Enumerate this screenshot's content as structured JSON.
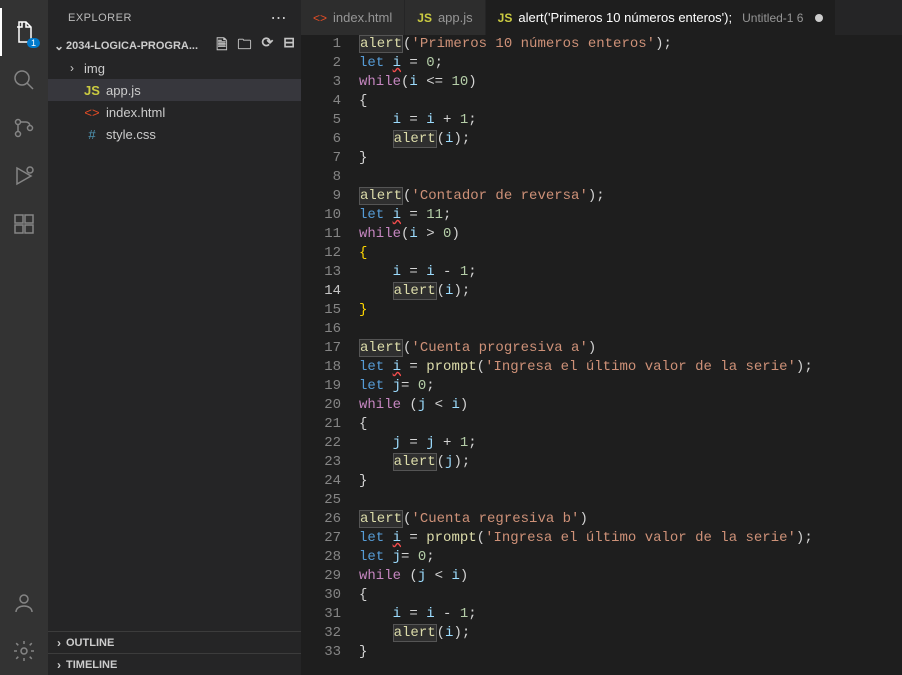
{
  "activity": {
    "explorer_badge": "1"
  },
  "sidebar": {
    "title": "EXPLORER",
    "project": "2034-LOGICA-PROGRA...",
    "tree": {
      "folder_img": "img",
      "file_appjs": "app.js",
      "file_index": "index.html",
      "file_style": "style.css"
    },
    "outline": "OUTLINE",
    "timeline": "TIMELINE"
  },
  "tabs": {
    "t0_label": "index.html",
    "t1_label": "app.js",
    "t2_label": "alert('Primeros 10 números enteros');",
    "t2_meta": "Untitled-1 6"
  },
  "code": {
    "lines": [
      [
        [
          "fn",
          "alert"
        ],
        [
          "def",
          "("
        ],
        [
          "str",
          "'Primeros 10 números enteros'"
        ],
        [
          "def",
          ");"
        ]
      ],
      [
        [
          "blue",
          "let "
        ],
        [
          "var",
          "i"
        ],
        [
          "def",
          " = "
        ],
        [
          "num",
          "0"
        ],
        [
          "def",
          ";"
        ]
      ],
      [
        [
          "kw",
          "while"
        ],
        [
          "def",
          "("
        ],
        [
          "var",
          "i"
        ],
        [
          "def",
          " <= "
        ],
        [
          "num",
          "10"
        ],
        [
          "def",
          ")"
        ]
      ],
      [
        [
          "def",
          "{"
        ]
      ],
      [
        [
          "def",
          "    "
        ],
        [
          "var",
          "i"
        ],
        [
          "def",
          " = "
        ],
        [
          "var",
          "i"
        ],
        [
          "def",
          " + "
        ],
        [
          "num",
          "1"
        ],
        [
          "def",
          ";"
        ]
      ],
      [
        [
          "def",
          "    "
        ],
        [
          "fn",
          "alert"
        ],
        [
          "def",
          "("
        ],
        [
          "var",
          "i"
        ],
        [
          "def",
          ");"
        ]
      ],
      [
        [
          "def",
          "}"
        ]
      ],
      [],
      [
        [
          "fn",
          "alert"
        ],
        [
          "def",
          "("
        ],
        [
          "str",
          "'Contador de reversa'"
        ],
        [
          "def",
          ");"
        ]
      ],
      [
        [
          "blue",
          "let "
        ],
        [
          "var",
          "i"
        ],
        [
          "def",
          " = "
        ],
        [
          "num",
          "11"
        ],
        [
          "def",
          ";"
        ]
      ],
      [
        [
          "kw",
          "while"
        ],
        [
          "def",
          "("
        ],
        [
          "var",
          "i"
        ],
        [
          "def",
          " > "
        ],
        [
          "num",
          "0"
        ],
        [
          "def",
          ")"
        ]
      ],
      [
        [
          "brace",
          "{"
        ]
      ],
      [
        [
          "def",
          "    "
        ],
        [
          "var",
          "i"
        ],
        [
          "def",
          " = "
        ],
        [
          "var",
          "i"
        ],
        [
          "def",
          " - "
        ],
        [
          "num",
          "1"
        ],
        [
          "def",
          ";"
        ]
      ],
      [
        [
          "def",
          "    "
        ],
        [
          "fn",
          "alert"
        ],
        [
          "def",
          "("
        ],
        [
          "var",
          "i"
        ],
        [
          "def",
          ");"
        ]
      ],
      [
        [
          "brace",
          "}"
        ]
      ],
      [],
      [
        [
          "fn",
          "alert"
        ],
        [
          "def",
          "("
        ],
        [
          "str",
          "'Cuenta progresiva a'"
        ],
        [
          "def",
          ")"
        ]
      ],
      [
        [
          "blue",
          "let "
        ],
        [
          "var",
          "i"
        ],
        [
          "def",
          " = "
        ],
        [
          "fn",
          "prompt"
        ],
        [
          "def",
          "("
        ],
        [
          "str",
          "'Ingresa el último valor de la serie'"
        ],
        [
          "def",
          ");"
        ]
      ],
      [
        [
          "blue",
          "let "
        ],
        [
          "var",
          "j"
        ],
        [
          "def",
          "= "
        ],
        [
          "num",
          "0"
        ],
        [
          "def",
          ";"
        ]
      ],
      [
        [
          "kw",
          "while"
        ],
        [
          "def",
          " ("
        ],
        [
          "var",
          "j"
        ],
        [
          "def",
          " < "
        ],
        [
          "var",
          "i"
        ],
        [
          "def",
          ")"
        ]
      ],
      [
        [
          "def",
          "{"
        ]
      ],
      [
        [
          "def",
          "    "
        ],
        [
          "var",
          "j"
        ],
        [
          "def",
          " = "
        ],
        [
          "var",
          "j"
        ],
        [
          "def",
          " + "
        ],
        [
          "num",
          "1"
        ],
        [
          "def",
          ";"
        ]
      ],
      [
        [
          "def",
          "    "
        ],
        [
          "fn",
          "alert"
        ],
        [
          "def",
          "("
        ],
        [
          "var",
          "j"
        ],
        [
          "def",
          ");"
        ]
      ],
      [
        [
          "def",
          "}"
        ]
      ],
      [],
      [
        [
          "fn",
          "alert"
        ],
        [
          "def",
          "("
        ],
        [
          "str",
          "'Cuenta regresiva b'"
        ],
        [
          "def",
          ")"
        ]
      ],
      [
        [
          "blue",
          "let "
        ],
        [
          "var",
          "i"
        ],
        [
          "def",
          " = "
        ],
        [
          "fn",
          "prompt"
        ],
        [
          "def",
          "("
        ],
        [
          "str",
          "'Ingresa el último valor de la serie'"
        ],
        [
          "def",
          ");"
        ]
      ],
      [
        [
          "blue",
          "let "
        ],
        [
          "var",
          "j"
        ],
        [
          "def",
          "= "
        ],
        [
          "num",
          "0"
        ],
        [
          "def",
          ";"
        ]
      ],
      [
        [
          "kw",
          "while"
        ],
        [
          "def",
          " ("
        ],
        [
          "var",
          "j"
        ],
        [
          "def",
          " < "
        ],
        [
          "var",
          "i"
        ],
        [
          "def",
          ")"
        ]
      ],
      [
        [
          "def",
          "{"
        ]
      ],
      [
        [
          "def",
          "    "
        ],
        [
          "var",
          "i"
        ],
        [
          "def",
          " = "
        ],
        [
          "var",
          "i"
        ],
        [
          "def",
          " - "
        ],
        [
          "num",
          "1"
        ],
        [
          "def",
          ";"
        ]
      ],
      [
        [
          "def",
          "    "
        ],
        [
          "fn",
          "alert"
        ],
        [
          "def",
          "("
        ],
        [
          "var",
          "i"
        ],
        [
          "def",
          ");"
        ]
      ],
      [
        [
          "def",
          "}"
        ]
      ]
    ],
    "cursor_line": 14,
    "squiggle_i_lines": [
      2,
      10,
      18,
      27
    ],
    "highlight_alert_lines": [
      1,
      6,
      9,
      14,
      17,
      23,
      26,
      32
    ]
  }
}
